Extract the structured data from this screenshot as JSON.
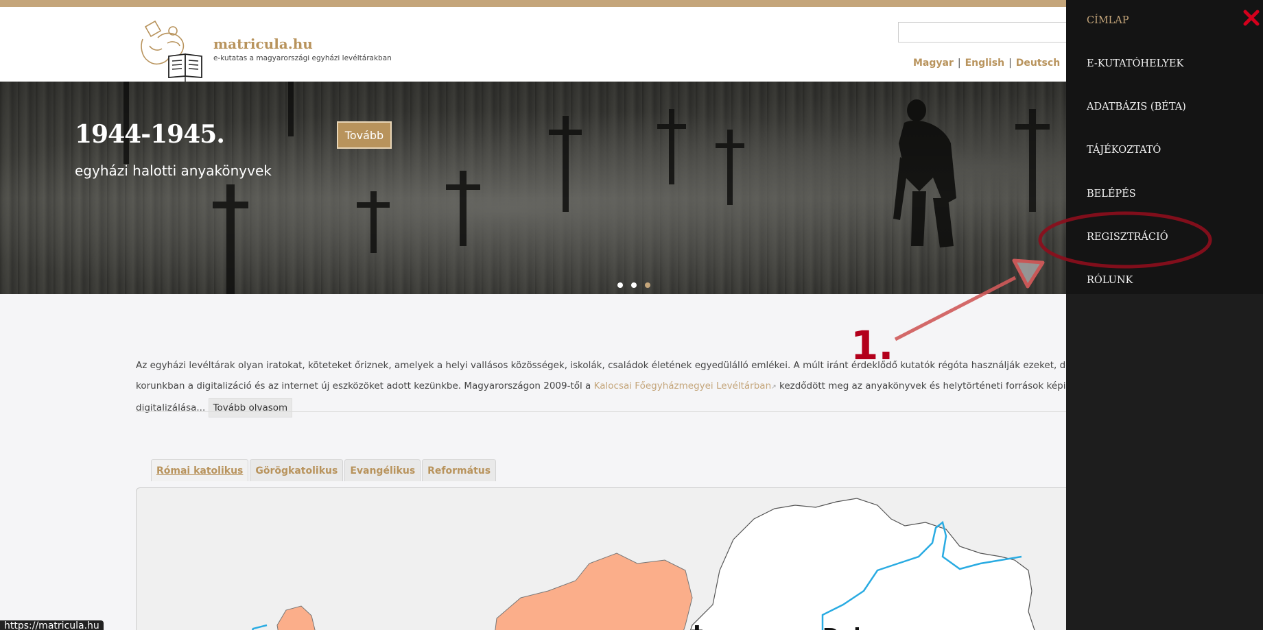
{
  "site": {
    "name": "matricula.hu",
    "tagline": "e-kutatas a magyarországi egyházi levéltárakban"
  },
  "languages": [
    "Magyar",
    "English",
    "Deutsch"
  ],
  "hero": {
    "title": "1944-1945.",
    "subtitle": "egyházi halotti anyakönyvek",
    "button": "Tovább",
    "active_slide": 3,
    "slide_count": 3
  },
  "intro": {
    "text_1": "Az egyházi levéltárak olyan iratokat, köteteket őriznek, amelyek a helyi vallásos közösségek, iskolák, családok életének egyedülálló emlékei. A múlt iránt érdeklődő kutatók régóta használják ezeket, de korunkban a digitalizáció és az internet új eszközöket adott kezünkbe. Magyarországon 2009-től a ",
    "link": "Kalocsai Főegyházmegyei Levéltárban",
    "text_2": " kezdődött meg az anyakönyvek és helytörténeti források képi digitalizálása...",
    "more_button": "Tovább olvasom"
  },
  "tabs": [
    "Római katolikus",
    "Görögkatolikus",
    "Evangélikus",
    "Református"
  ],
  "map": {
    "label": "Debrecen-",
    "symbol": "‡"
  },
  "menu": {
    "items": [
      "CÍMLAP",
      "E-KUTATÓHELYEK",
      "ADATBÁZIS (BÉTA)",
      "TÁJÉKOZTATÓ",
      "BELÉPÉS",
      "REGISZTRÁCIÓ",
      "RÓLUNK"
    ],
    "active": "CÍMLAP",
    "close_icon": "close-x-icon"
  },
  "annotation": {
    "label": "1.",
    "color": "#b3001b"
  },
  "status_bar": {
    "url": "https://matricula.hu"
  },
  "colors": {
    "accent": "#c4a57a",
    "brand": "#b8935c",
    "menu_bg": "#1d1d1d",
    "annotation": "#b3001b",
    "map_orange": "#fbae8a",
    "map_blue": "#29abe2"
  }
}
